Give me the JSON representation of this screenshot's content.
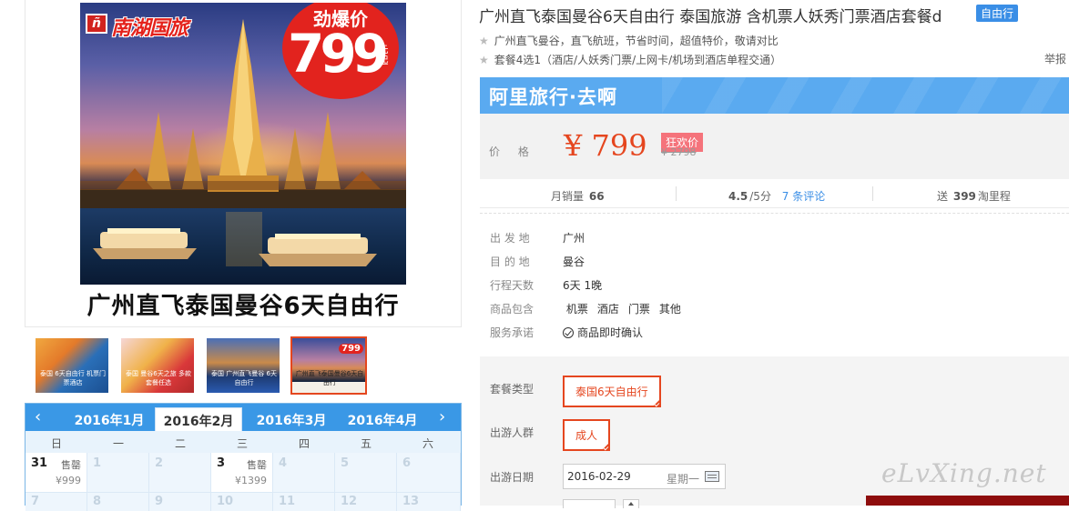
{
  "gallery": {
    "poster": {
      "brand": "南湖国旅",
      "brand_mark": "ñ",
      "promo_kicker": "劲爆价",
      "promo_price": "799",
      "promo_unit": "元起",
      "caption": "广州直飞泰国曼谷6天自由行"
    },
    "thumbnails": [
      {
        "label": "泰国 6天自由行 机票门票酒店"
      },
      {
        "label": "泰国 曼谷6天之旅 多款套餐任选"
      },
      {
        "label": "泰国 广州直飞曼谷 6天自由行"
      },
      {
        "label": "广州直飞泰国曼谷6天自由行",
        "badge": "799"
      }
    ]
  },
  "calendar": {
    "prev_icon": "chevron-left-icon",
    "next_icon": "chevron-right-icon",
    "months": [
      "2016年1月",
      "2016年2月",
      "2016年3月",
      "2016年4月"
    ],
    "active_month_index": 1,
    "weekdays": [
      "日",
      "一",
      "二",
      "三",
      "四",
      "五",
      "六"
    ],
    "row1": [
      {
        "day": "31",
        "tag": "售罄",
        "price": "¥999",
        "available": true
      },
      {
        "day": "1",
        "available": false
      },
      {
        "day": "2",
        "available": false
      },
      {
        "day": "3",
        "tag": "售罄",
        "price": "¥1399",
        "available": true
      },
      {
        "day": "4",
        "available": false
      },
      {
        "day": "5",
        "available": false
      },
      {
        "day": "6",
        "available": false
      }
    ],
    "row2": [
      "7",
      "8",
      "9",
      "10",
      "11",
      "12",
      "13"
    ]
  },
  "product": {
    "title": "广州直飞泰国曼谷6天自由行 泰国旅游 含机票人妖秀门票酒店套餐d",
    "badge": "自由行",
    "features": [
      "广州直飞曼谷，直飞航班，节省时间，超值特价，敬请对比",
      "套餐4选1（酒店/人妖秀门票/上网卡/机场到酒店单程交通）"
    ],
    "report": "举报"
  },
  "promo": {
    "brand": "阿里旅行·去啊",
    "price_label": "价 格",
    "price": "¥ 799",
    "price_tag": "狂欢价",
    "original_price": "¥ 2798"
  },
  "stats": {
    "monthly_sales_label": "月销量",
    "monthly_sales": "66",
    "rating": "4.5",
    "rating_max": "/5分",
    "reviews": "7 条评论",
    "points_prefix": "送",
    "points": "399",
    "points_suffix": "淘里程"
  },
  "info": [
    {
      "key": "出 发 地",
      "value": "广州"
    },
    {
      "key": "目 的 地",
      "value": "曼谷"
    },
    {
      "key": "行程天数",
      "value": "6天 1晚"
    },
    {
      "key": "商品包含",
      "items": [
        "机票",
        "酒店",
        "门票",
        "其他"
      ]
    },
    {
      "key": "服务承诺",
      "value": "商品即时确认"
    }
  ],
  "selection": {
    "package_label": "套餐类型",
    "package_value": "泰国6天自由行",
    "travelers_label": "出游人群",
    "travelers_value": "成人",
    "date_label": "出游日期",
    "date_value": "2016-02-29",
    "date_weekday": "星期一"
  },
  "watermark": "eLvXing.net",
  "colors": {
    "accent": "#e5461f",
    "calendar_blue": "#3a98e6",
    "promo_blue": "#5aaaf0",
    "badge_blue": "#3a8ee6"
  }
}
